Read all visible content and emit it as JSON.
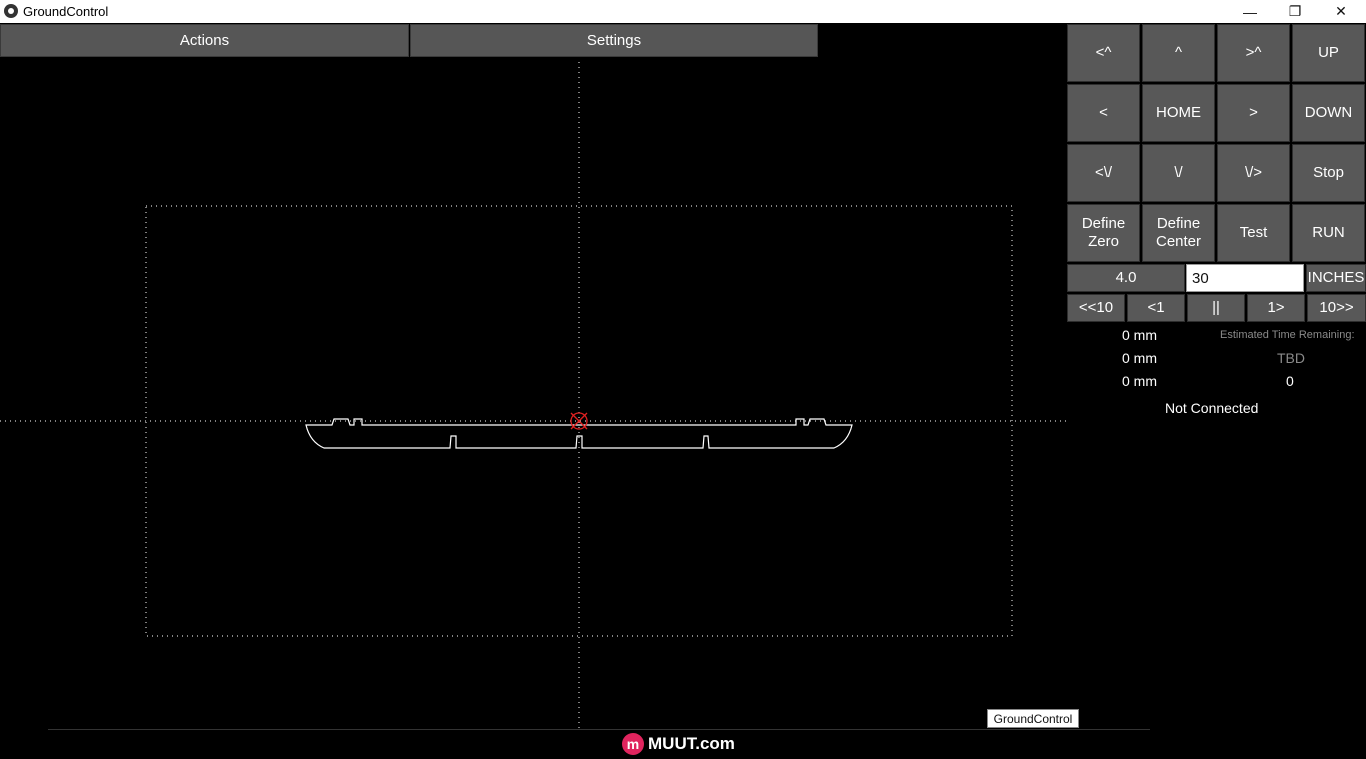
{
  "window": {
    "title": "GroundControl",
    "minimize_glyph": "—",
    "maximize_glyph": "❐",
    "close_glyph": "✕"
  },
  "menu": {
    "actions_label": "Actions",
    "settings_label": "Settings"
  },
  "controls": {
    "row1": [
      "<^",
      "^",
      ">^",
      "UP"
    ],
    "row2": [
      "<",
      "HOME",
      ">",
      "DOWN"
    ],
    "row3": [
      "<\\/",
      "\\/",
      "\\/>",
      "Stop"
    ],
    "row4": [
      "Define Zero",
      "Define Center",
      "Test",
      "RUN"
    ],
    "step_value": "4.0",
    "distance_input": "30",
    "units_label": "INCHES",
    "playback": [
      "<<10",
      "<1",
      "||",
      "1>",
      "10>>"
    ]
  },
  "readouts": {
    "x": "0 mm",
    "y": "0 mm",
    "z": "0 mm",
    "estimated_time_label": "Estimated Time Remaining:",
    "estimated_time_value": "TBD",
    "line_number": "0",
    "connection_status": "Not Connected"
  },
  "tooltip": "GroundControl",
  "brand": {
    "mark": "m",
    "text": "MUUT.com"
  },
  "colors": {
    "canvas_background": "#000000",
    "button_gray": "#585858",
    "marker_red": "#e02020",
    "brand_pink": "#e0245e"
  }
}
